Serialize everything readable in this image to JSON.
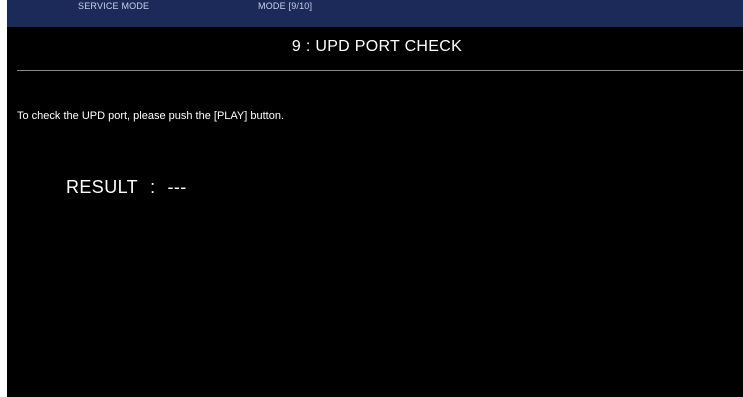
{
  "header": {
    "mode_label": "SERVICE MODE",
    "mode_page": "MODE [9/10]"
  },
  "screen": {
    "title": "9 : UPD PORT CHECK",
    "instruction": "To check the UPD port, please push the [PLAY] button.",
    "result_label": "RESULT",
    "result_separator": ":",
    "result_value": "---"
  },
  "colors": {
    "header_background": "#1c2a5a",
    "screen_background": "#000000",
    "text": "#ffffff",
    "divider": "#8a8a8a"
  }
}
